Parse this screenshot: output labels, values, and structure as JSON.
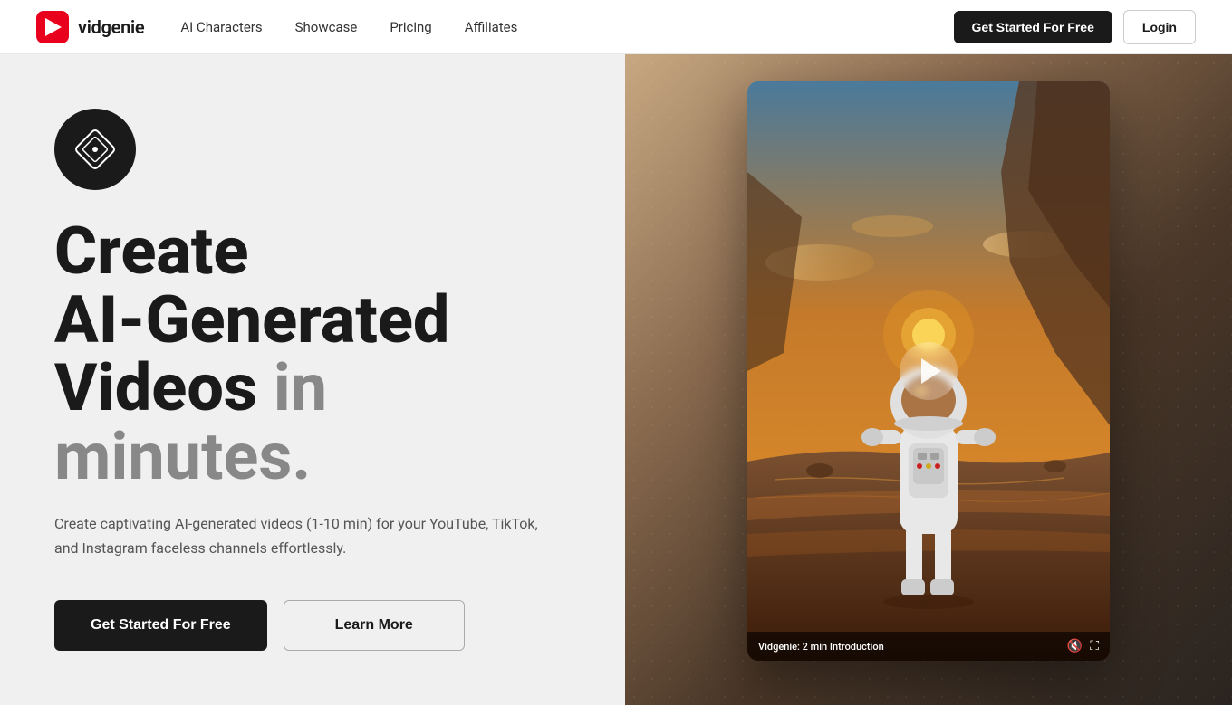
{
  "brand": {
    "name": "vidgenie",
    "logo_alt": "vidgenie logo"
  },
  "nav": {
    "links": [
      {
        "id": "ai-characters",
        "label": "AI Characters"
      },
      {
        "id": "showcase",
        "label": "Showcase"
      },
      {
        "id": "pricing",
        "label": "Pricing"
      },
      {
        "id": "affiliates",
        "label": "Affiliates"
      }
    ],
    "cta_label": "Get Started For Free",
    "login_label": "Login"
  },
  "hero": {
    "heading_line1": "Create",
    "heading_line2": "AI-Generated",
    "heading_line3_main": "Videos",
    "heading_line3_highlight": " in minutes.",
    "subtext": "Create captivating AI-generated videos (1-10 min) for your YouTube, TikTok, and Instagram faceless channels effortlessly.",
    "cta_primary": "Get Started For Free",
    "cta_secondary": "Learn More"
  },
  "video": {
    "title": "Vidgenie: 2 min Introduction",
    "mute_icon": "mute-icon",
    "fullscreen_icon": "fullscreen-icon"
  },
  "colors": {
    "primary_bg": "#f0f0f0",
    "nav_bg": "#ffffff",
    "brand_dark": "#1a1a1a",
    "highlight_gray": "#888888",
    "text_body": "#555555"
  }
}
